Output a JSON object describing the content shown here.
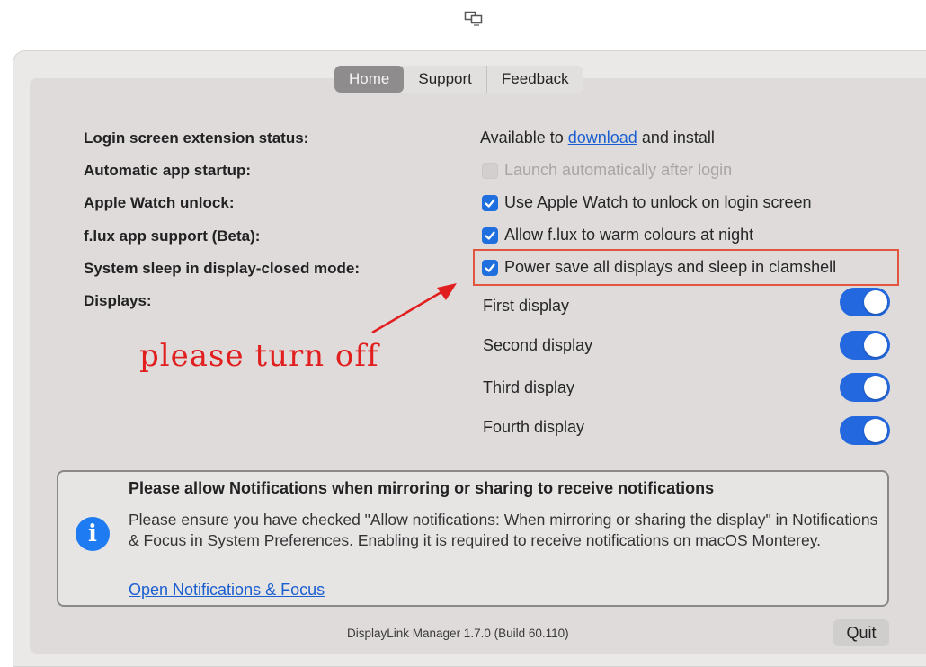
{
  "tabs": [
    "Home",
    "Support",
    "Feedback"
  ],
  "labels": {
    "login_status": "Login screen extension status:",
    "app_startup": "Automatic app startup:",
    "watch_unlock": "Apple Watch unlock:",
    "flux": "f.lux app support (Beta):",
    "sleep": "System sleep in display-closed mode:",
    "displays": "Displays:"
  },
  "login_status": {
    "prefix": "Available to",
    "link": "download",
    "suffix": "and install"
  },
  "options": {
    "app_startup": {
      "text": "Launch automatically after login",
      "checked": false,
      "disabled": true
    },
    "watch_unlock": {
      "text": "Use Apple Watch to unlock on login screen",
      "checked": true
    },
    "flux": {
      "text": "Allow f.lux to warm colours at night",
      "checked": true
    },
    "sleep": {
      "text": "Power save all displays and sleep in clamshell",
      "checked": true
    }
  },
  "displays": [
    {
      "name": "First display",
      "on": true
    },
    {
      "name": "Second display",
      "on": true
    },
    {
      "name": "Third display",
      "on": true
    },
    {
      "name": "Fourth display",
      "on": true
    }
  ],
  "annotation": "please turn off",
  "notice": {
    "title": "Please allow Notifications when mirroring or sharing to receive notifications",
    "body": "Please ensure you have checked \"Allow notifications: When mirroring or sharing the display\" in Notifications & Focus in System Preferences. Enabling it is required to receive notifications on macOS Monterey.",
    "link": "Open Notifications & Focus",
    "icon_glyph": "i"
  },
  "footer": "DisplayLink Manager 1.7.0 (Build 60.110)",
  "quit_label": "Quit",
  "colors": {
    "accent": "#1f6fde",
    "annotation": "#e21f1f",
    "highlight_border": "#e2553e"
  }
}
